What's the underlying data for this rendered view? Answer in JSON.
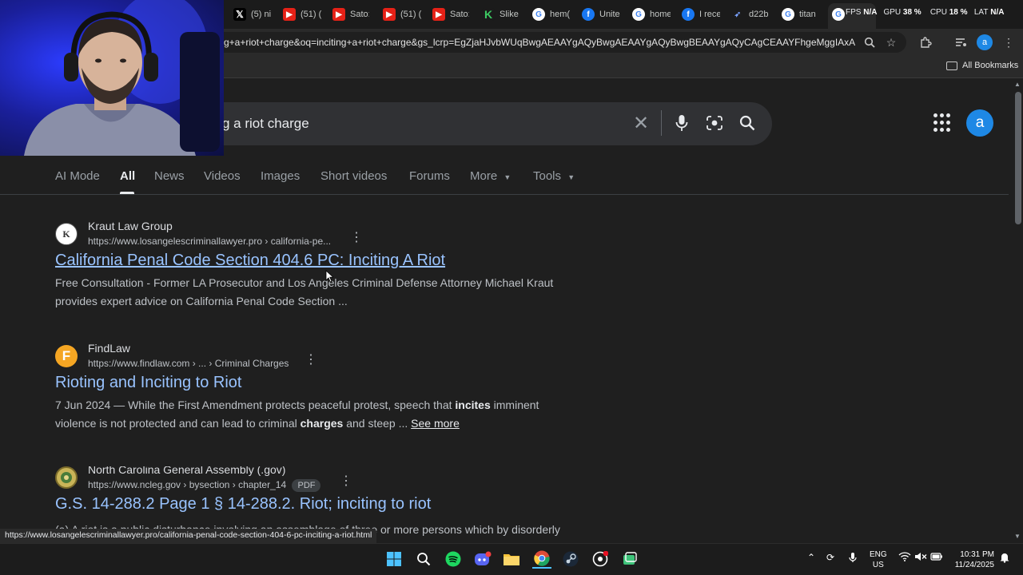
{
  "tabs": [
    {
      "icon": "x-icon",
      "label": "(5) ni"
    },
    {
      "icon": "youtube-icon",
      "label": "(51) ("
    },
    {
      "icon": "youtube-icon",
      "label": "Sato:"
    },
    {
      "icon": "youtube-icon",
      "label": "(51) ("
    },
    {
      "icon": "youtube-icon",
      "label": "Sato:"
    },
    {
      "icon": "kick-icon",
      "label": "Slike"
    },
    {
      "icon": "google-icon",
      "label": "hem("
    },
    {
      "icon": "facebook-icon",
      "label": "Unite"
    },
    {
      "icon": "google-icon",
      "label": "home"
    },
    {
      "icon": "facebook-icon",
      "label": "I rece"
    },
    {
      "icon": "arrow-icon",
      "label": "d22b"
    },
    {
      "icon": "google-icon",
      "label": "titan"
    }
  ],
  "performance_overlay": {
    "fps_label": "FPS",
    "fps_value": "N/A",
    "gpu_label": "GPU",
    "gpu_value": "38 %",
    "cpu_label": "CPU",
    "cpu_value": "18 %",
    "lat_label": "LAT",
    "lat_value": "N/A"
  },
  "address_bar": {
    "url": "g+a+riot+charge&oq=inciting+a+riot+charge&gs_lcrp=EgZjaHJvbWUqBwgAEAAYgAQyBwgAEAAYgAQyBwgBEAAYgAQyCAgCEAAYFhgeMggIAxAAGBY..."
  },
  "bookmarks": {
    "all_label": "All Bookmarks"
  },
  "profile_initial": "a",
  "search": {
    "query": "g a riot charge"
  },
  "nav_tabs": {
    "ai_mode": "AI Mode",
    "all": "All",
    "news": "News",
    "videos": "Videos",
    "images": "Images",
    "short_videos": "Short videos",
    "forums": "Forums",
    "more": "More",
    "tools": "Tools"
  },
  "results": [
    {
      "site": "Kraut Law Group",
      "favicon_letter": "K",
      "url": "https://www.losangelescriminallawyer.pro › california-pe...",
      "title": "California Penal Code Section 404.6 PC: Inciting A Riot",
      "snippet_line1": "Free Consultation - Former LA Prosecutor and Los Angeles Criminal Defense Attorney Michael Kraut",
      "snippet_line2": "provides expert advice on California Penal Code Section ..."
    },
    {
      "site": "FindLaw",
      "favicon_letter": "F",
      "url": "https://www.findlaw.com › ... › Criminal Charges",
      "title": "Rioting and Inciting to Riot",
      "date": "7 Jun 2024",
      "snippet_a": " — While the First Amendment protects peaceful protest, speech that ",
      "snippet_bold1": "incites",
      "snippet_b": " imminent",
      "snippet_c": "violence is not protected and can lead to criminal ",
      "snippet_bold2": "charges",
      "snippet_d": " and steep ... ",
      "see_more": "See more"
    },
    {
      "site": "North Carolina General Assembly (.gov)",
      "url": "https://www.ncleg.gov › bysection › chapter_14",
      "badge": "PDF",
      "title": "G.S. 14-288.2 Page 1 § 14-288.2. Riot; inciting to riot",
      "snippet_line1": "(a) A riot is a public disturbance involving an assemblage of three or more persons which by disorderly"
    }
  ],
  "status_url": "https://www.losangelescriminallawyer.pro/california-penal-code-section-404-6-pc-inciting-a-riot.html",
  "taskbar": {
    "lang_line1": "ENG",
    "lang_line2": "US",
    "time": "10:31 PM",
    "date": "11/24/2025"
  }
}
